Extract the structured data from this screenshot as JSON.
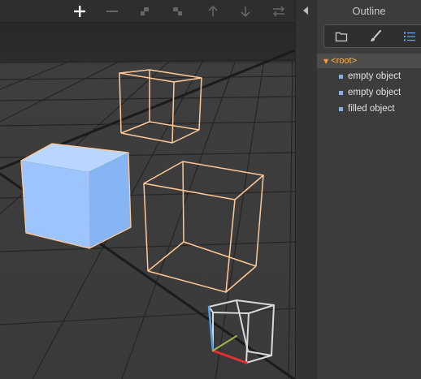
{
  "toolbar": {
    "buttons": [
      {
        "icon": "plus-icon"
      },
      {
        "icon": "minus-icon"
      },
      {
        "icon": "move-left-icon"
      },
      {
        "icon": "move-right-icon"
      },
      {
        "icon": "arrow-up-icon"
      },
      {
        "icon": "arrow-down-icon"
      },
      {
        "icon": "swap-icon"
      }
    ]
  },
  "panel": {
    "title": "Outline",
    "tabs": [
      {
        "icon": "folder-icon",
        "active": false
      },
      {
        "icon": "brush-icon",
        "active": false
      },
      {
        "icon": "list-icon",
        "active": true
      }
    ]
  },
  "tree": {
    "root_label": "<root>",
    "items": [
      {
        "label": "empty object"
      },
      {
        "label": "empty object"
      },
      {
        "label": "filled object"
      }
    ]
  },
  "colors": {
    "selection_wireframe": "#ffc896",
    "filled_cube": "#9cc4ff",
    "root_label": "#ffb347",
    "accent_blue": "#6aa8ff",
    "axis_x": "#e53030",
    "axis_y": "#9bb84a",
    "axis_z": "#5aa0e6"
  }
}
